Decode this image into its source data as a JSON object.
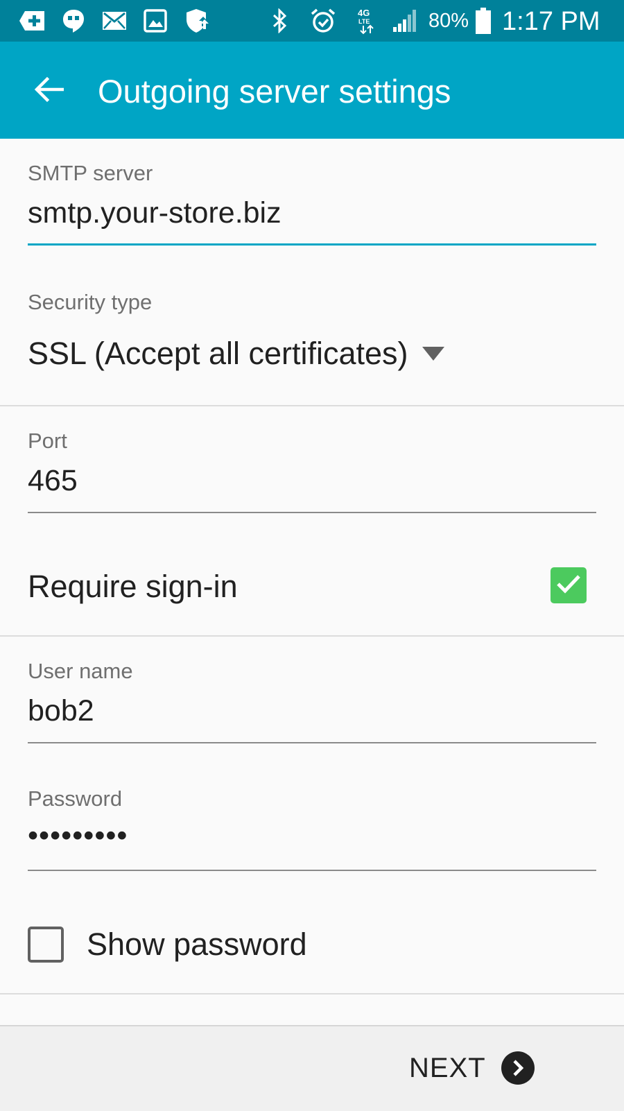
{
  "status_bar": {
    "battery_percent": "80%",
    "time": "1:17 PM",
    "network_label": "4G LTE",
    "icons": [
      "add-icon",
      "hangouts-icon",
      "mail-icon",
      "gallery-icon",
      "shield-icon",
      "bluetooth-icon",
      "alarm-icon",
      "lte-icon",
      "signal-icon",
      "battery-icon"
    ]
  },
  "app_bar": {
    "title": "Outgoing server settings",
    "background_color": "#00a5c5"
  },
  "form": {
    "smtp_server": {
      "label": "SMTP server",
      "value": "smtp.your-store.biz"
    },
    "security_type": {
      "label": "Security type",
      "value": "SSL (Accept all certificates)"
    },
    "port": {
      "label": "Port",
      "value": "465"
    },
    "require_signin": {
      "label": "Require sign-in",
      "checked": true
    },
    "user_name": {
      "label": "User name",
      "value": "bob2"
    },
    "password": {
      "label": "Password",
      "value": "•••••••••"
    },
    "show_password": {
      "label": "Show password",
      "checked": false
    }
  },
  "footer": {
    "next_label": "NEXT"
  },
  "colors": {
    "accent": "#00a5c5",
    "status_bar": "#00819a",
    "checkbox_checked": "#4cca5e"
  }
}
